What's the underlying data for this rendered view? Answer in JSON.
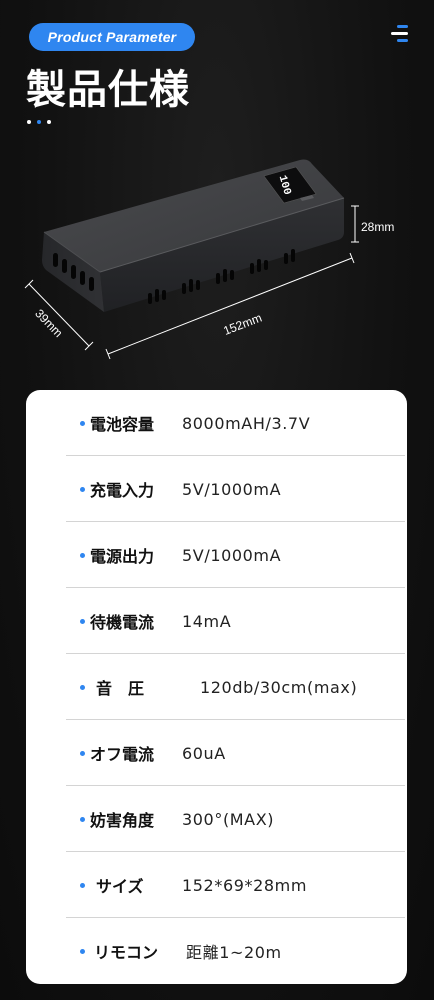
{
  "header": {
    "badge_label": "Product Parameter",
    "menu_icon": "menu-icon",
    "title": "製品仕様",
    "dots": [
      {
        "color": "#ffffff"
      },
      {
        "color": "#2f86f0"
      },
      {
        "color": "#ffffff"
      }
    ]
  },
  "product": {
    "image": "power-bank-image",
    "display_text": "100",
    "dimensions": {
      "height": "28mm",
      "length": "152mm",
      "width": "39mm"
    }
  },
  "specs": [
    {
      "label": "電池容量",
      "value": "8000mAH/3.7V"
    },
    {
      "label": "充電入力",
      "value": "5V/1000mA"
    },
    {
      "label": "電源出力",
      "value": "5V/1000mA"
    },
    {
      "label": "待機電流",
      "value": "14mA"
    },
    {
      "label": "音　圧",
      "value": "120db/30cm(max)"
    },
    {
      "label": "オフ電流",
      "value": "60uA"
    },
    {
      "label": "妨害角度",
      "value": "300°(MAX)"
    },
    {
      "label": "サイズ",
      "value": "152*69*28mm"
    },
    {
      "label": "リモコン",
      "value": "距離1~20m"
    }
  ],
  "colors": {
    "accent": "#2f86f0",
    "background": "#121212",
    "card": "#ffffff"
  }
}
